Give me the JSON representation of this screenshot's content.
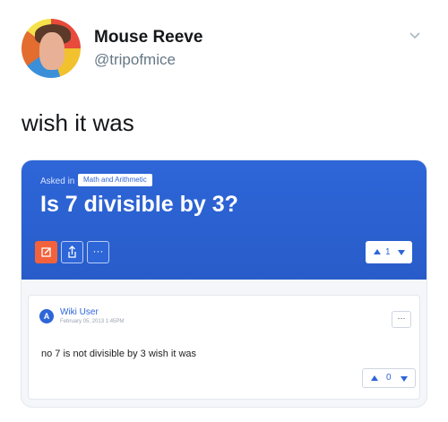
{
  "tweet": {
    "author_name": "Mouse Reeve",
    "handle": "@tripofmice",
    "text": "wish it was"
  },
  "card": {
    "asked_label": "Asked in",
    "tag": "Math and Arithmetic",
    "question": "Is 7 divisible by 3?",
    "actions": {
      "more_label": "···"
    },
    "question_votes": "1"
  },
  "answer": {
    "avatar_letter": "A",
    "user": "Wiki User",
    "date": "February 05, 2013 1:45PM",
    "more_label": "···",
    "text": "no 7 is not divisible by 3 wish it was",
    "votes": "0"
  },
  "colors": {
    "accent": "#2e66d8",
    "edit": "#f2623c"
  }
}
